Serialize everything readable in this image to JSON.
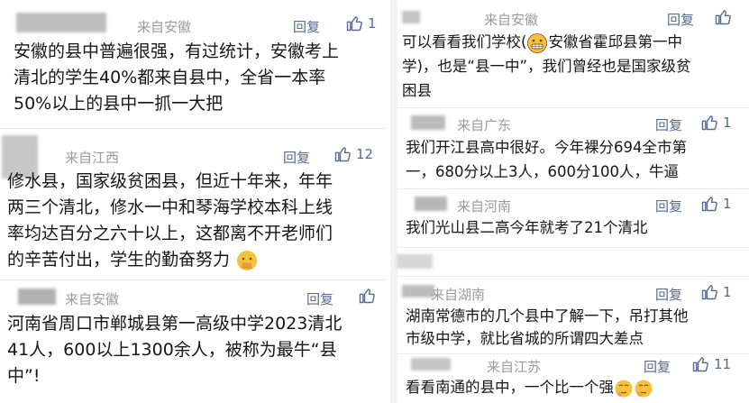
{
  "comments": [
    {
      "from": "来自安徽",
      "reply": "回复",
      "likes": "1",
      "lines": [
        "安徽的县中普遍很强，有过统计，安徽考上",
        "清北的学生40%都来自县中，全省一本率",
        "50%以上的县中一抓一大把"
      ]
    },
    {
      "from": "来自江西",
      "reply": "回复",
      "likes": "12",
      "lines": [
        "修水县，国家级贫困县，但近十年来，年年",
        "两三个清北，修水一中和琴海学校本科上线",
        "率均达百分之六十以上，这都离不开老师们",
        "的辛苦付出，学生的勤奋努力"
      ]
    },
    {
      "from": "来自安徽",
      "reply": "回复",
      "likes": "",
      "lines": [
        "河南省周口市郸城县第一高级中学2023清北",
        "41人，600以上1300余人，被称为最牛“县",
        "中”!"
      ]
    },
    {
      "from": "来自安徽",
      "reply": "回复",
      "likes": "",
      "lines": [
        "可以看看我们学校(",
        "安徽省霍邱县第一中",
        "学)，也是“县一中”，我们曾经也是国家级贫",
        "困县"
      ]
    },
    {
      "from": "来自广东",
      "reply": "回复",
      "likes": "1",
      "lines": [
        "我们开江县高中很好。今年裸分694全市第",
        "一，680分以上3人，600分100人，牛逼"
      ]
    },
    {
      "from": "来自河南",
      "reply": "回复",
      "likes": "1",
      "lines": [
        "我们光山县二高今年就考了21个清北"
      ]
    },
    {
      "from": "来自湖南",
      "reply": "回复",
      "likes": "1",
      "lines": [
        "湖南常德市的几个县中了解一下，吊打其他",
        "市级中学，就比省城的所谓四大差点"
      ]
    },
    {
      "from": "来自江苏",
      "reply": "回复",
      "likes": "11",
      "lines": [
        "看看南通的县中，一个比一个强"
      ]
    }
  ],
  "colors": {
    "link": "#576b95",
    "meta": "#9b9b9b",
    "text": "#161616"
  }
}
